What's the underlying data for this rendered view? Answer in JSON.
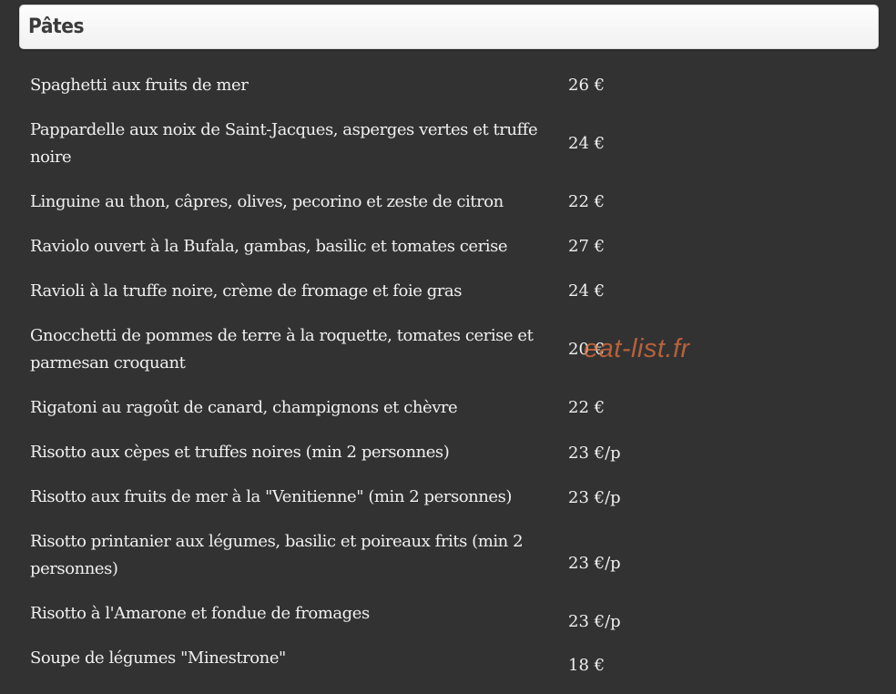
{
  "section": {
    "title": "Pâtes"
  },
  "items": [
    {
      "name": "Spaghetti aux fruits de mer",
      "price": "26 €"
    },
    {
      "name": "Pappardelle aux noix de Saint-Jacques, asperges vertes et truffe noire",
      "price": "24 €"
    },
    {
      "name": "Linguine au thon, câpres, olives, pecorino et zeste de citron",
      "price": "22 €"
    },
    {
      "name": "Raviolo ouvert à la Bufala, gambas, basilic et tomates cerise",
      "price": "27 €"
    },
    {
      "name": "Ravioli à la truffe noire, crème de fromage et foie gras",
      "price": "24 €"
    },
    {
      "name": "Gnocchetti de pommes de terre à la roquette, tomates cerise et parmesan croquant",
      "price": "20 €"
    },
    {
      "name": "Rigatoni au ragoût de canard, champignons et chèvre",
      "price": "22 €"
    },
    {
      "name": "Risotto aux cèpes et truffes noires (min 2 personnes)",
      "price": "23 €/p"
    },
    {
      "name": "Risotto aux fruits de mer à la \"Venitienne\" (min 2 personnes)",
      "price": "23 €/p"
    },
    {
      "name": "Risotto printanier aux légumes, basilic et poireaux frits (min 2 personnes)",
      "price": "23 €/p"
    },
    {
      "name": "Risotto à l'Amarone et fondue de fromages",
      "price": "23 €/p"
    },
    {
      "name": "Soupe de légumes \"Minestrone\"",
      "price": "18 €"
    }
  ],
  "watermark": {
    "text": "eat-list.fr"
  }
}
